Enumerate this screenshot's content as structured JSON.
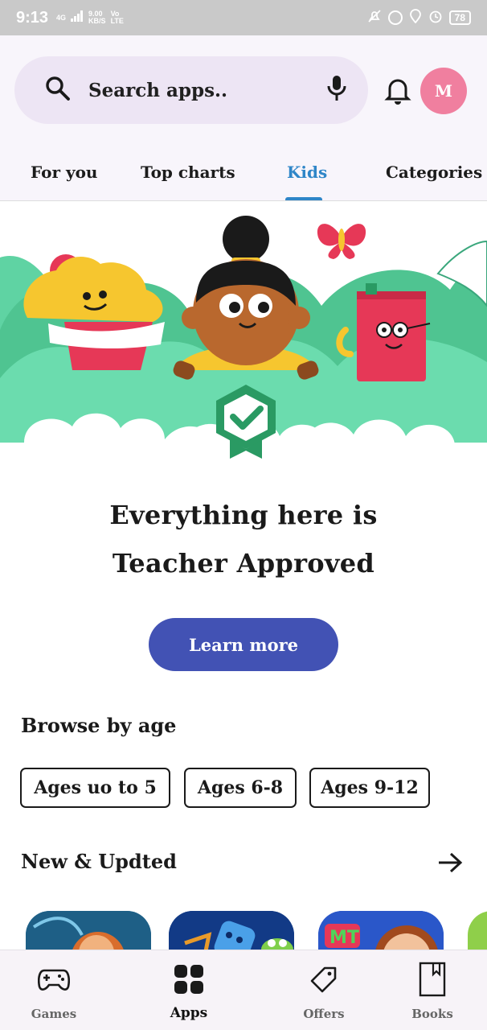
{
  "status_bar": {
    "time": "9:13",
    "network_top": "4G",
    "speed_value": "9.00",
    "speed_unit": "KB/S",
    "volte_top": "Vo",
    "volte_bottom": "LTE",
    "battery": "78"
  },
  "search": {
    "placeholder": "Search apps.."
  },
  "profile": {
    "initial": "M",
    "color": "#f07f9f"
  },
  "tabs": [
    {
      "label": "For you"
    },
    {
      "label": "Top charts"
    },
    {
      "label": "Kids",
      "active": true
    },
    {
      "label": "Categories"
    }
  ],
  "hero": {
    "headline_line1": "Everything here is",
    "headline_line2": "Teacher Approved",
    "cta": "Learn more"
  },
  "browse_by_age": {
    "title": "Browse by age",
    "chips": [
      "Ages uo to 5",
      "Ages 6-8",
      "Ages 9-12"
    ]
  },
  "new_updated": {
    "title": "New & Updted"
  },
  "bottom_nav": [
    {
      "label": "Games",
      "icon": "gamepad-icon"
    },
    {
      "label": "Apps",
      "icon": "apps-grid-icon",
      "active": true
    },
    {
      "label": "Offers",
      "icon": "tag-icon"
    },
    {
      "label": "Books",
      "icon": "book-icon"
    }
  ],
  "colors": {
    "accent": "#2f86c8",
    "cta": "#4252b4",
    "search_bg": "#ede5f4"
  }
}
